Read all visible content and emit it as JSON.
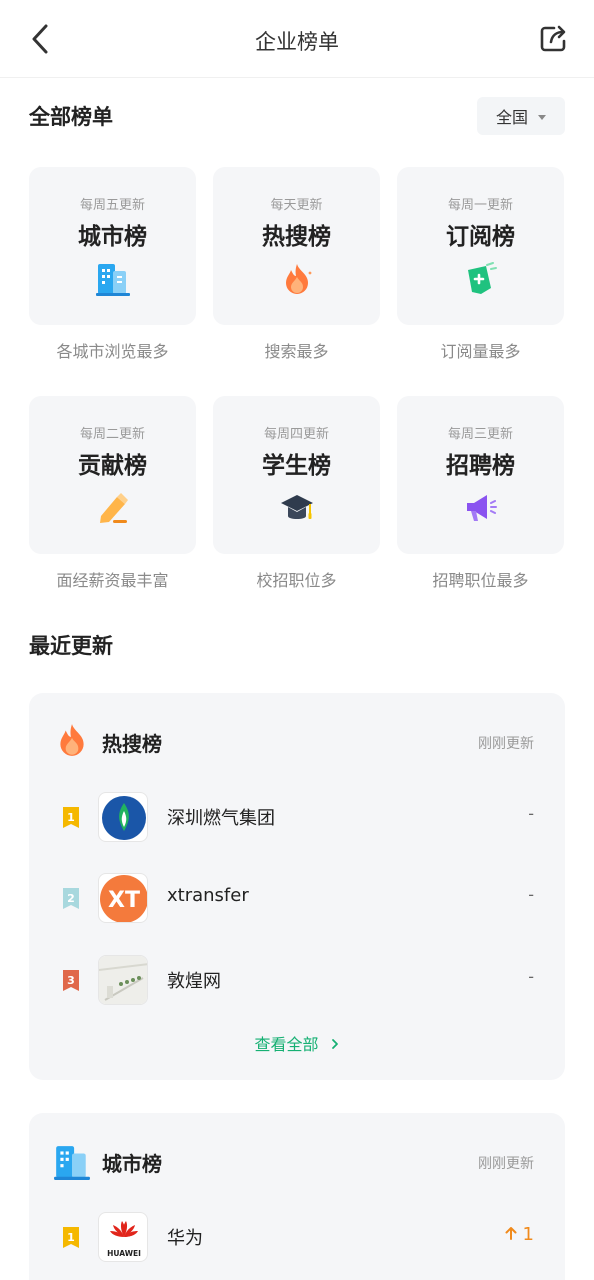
{
  "header": {
    "title": "企业榜单"
  },
  "all_section": {
    "title": "全部榜单",
    "region": "全国"
  },
  "categories": [
    {
      "freq": "每周五更新",
      "name": "城市榜",
      "desc": "各城市浏览最多",
      "icon": "city-building-icon"
    },
    {
      "freq": "每天更新",
      "name": "热搜榜",
      "desc": "搜索最多",
      "icon": "flame-icon"
    },
    {
      "freq": "每周一更新",
      "name": "订阅榜",
      "desc": "订阅量最多",
      "icon": "subscribe-tag-icon"
    },
    {
      "freq": "每周二更新",
      "name": "贡献榜",
      "desc": "面经薪资最丰富",
      "icon": "pencil-icon"
    },
    {
      "freq": "每周四更新",
      "name": "学生榜",
      "desc": "校招职位多",
      "icon": "graduation-cap-icon"
    },
    {
      "freq": "每周三更新",
      "name": "招聘榜",
      "desc": "招聘职位最多",
      "icon": "megaphone-icon"
    }
  ],
  "recent_section": {
    "title": "最近更新"
  },
  "hot_card": {
    "title": "热搜榜",
    "updated": "刚刚更新",
    "rows": [
      {
        "rank": "1",
        "name": "深圳燃气集团",
        "value": "-"
      },
      {
        "rank": "2",
        "name": "xtransfer",
        "value": "-",
        "logo_text": "XT"
      },
      {
        "rank": "3",
        "name": "敦煌网",
        "value": "-"
      }
    ],
    "view_all": "查看全部"
  },
  "city_card": {
    "title": "城市榜",
    "updated": "刚刚更新",
    "rows": [
      {
        "rank": "1",
        "name": "华为",
        "value": "1",
        "logo_text": "HUAWEI"
      }
    ]
  },
  "colors": {
    "accent_green": "#16b073",
    "rank1": "#f5b800",
    "rank2": "#a8d8de",
    "rank3": "#e0684a",
    "trend_up": "#f08a1c"
  }
}
